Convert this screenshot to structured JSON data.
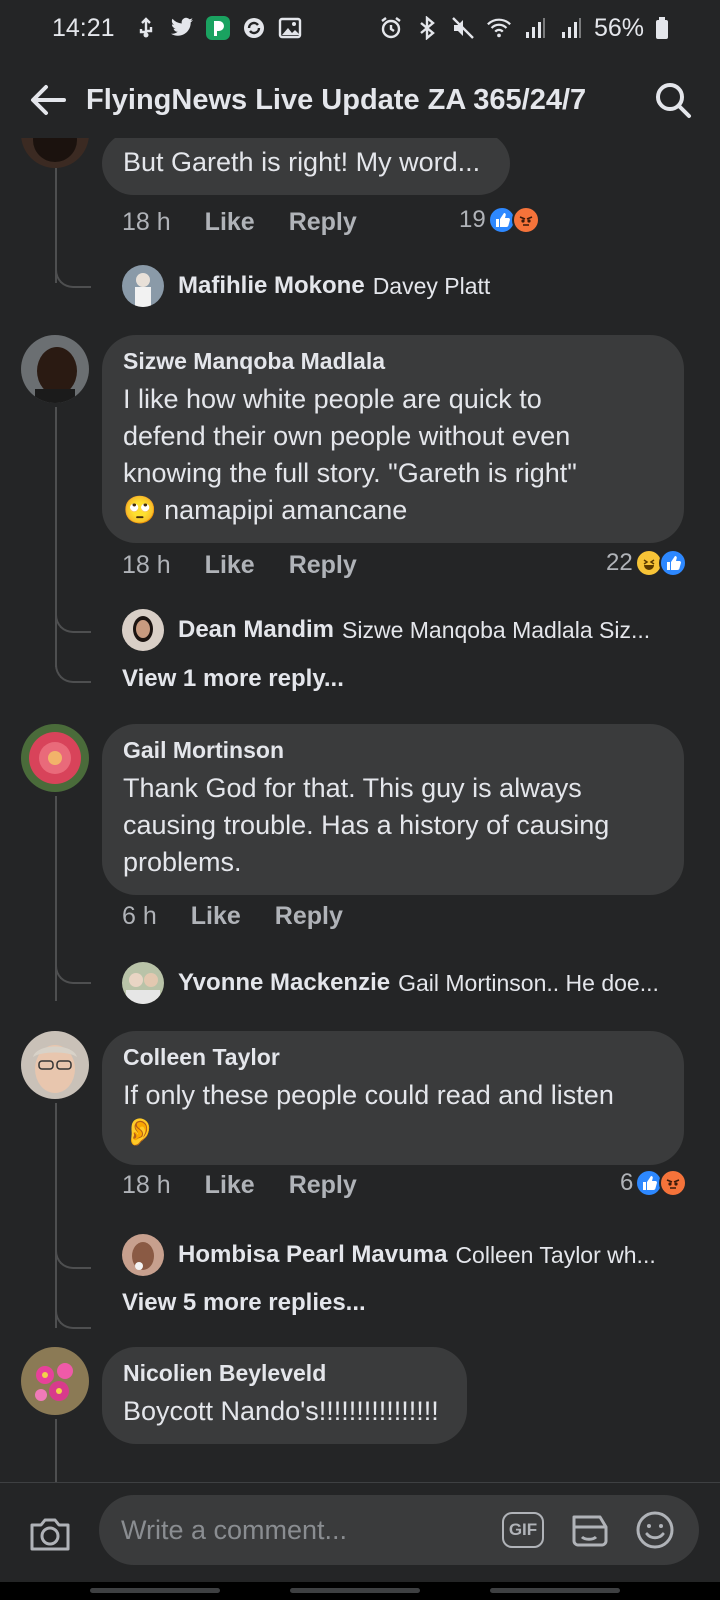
{
  "status_bar": {
    "time": "14:21",
    "battery": "56%",
    "left_icons": [
      "usb-icon",
      "twitter-icon",
      "p-app-icon",
      "sync-icon",
      "image-icon"
    ],
    "right_icons": [
      "alarm-icon",
      "bluetooth-icon",
      "mute-icon",
      "wifi-icon",
      "signal-icon",
      "signal-icon",
      "battery-icon"
    ]
  },
  "header": {
    "title": "FlyingNews Live Update ZA 365/24/7"
  },
  "comments": [
    {
      "name": "",
      "text": "But Gareth is right! My word...",
      "time": "18 h",
      "like_label": "Like",
      "reply_label": "Reply",
      "reaction_count": "19",
      "reactions": [
        "like",
        "angry"
      ],
      "reply_preview": {
        "name": "Mafihlie Mokone",
        "text": "Davey Platt"
      }
    },
    {
      "name": "Sizwe Manqoba Madlala",
      "text_lines": [
        "I like how white people are quick to",
        "defend their own people without even",
        "knowing the full story. \"Gareth is right\""
      ],
      "last_line_emoji": "🙄",
      "last_line_text": "namapipi amancane",
      "time": "18 h",
      "like_label": "Like",
      "reply_label": "Reply",
      "reaction_count": "22",
      "reactions": [
        "haha",
        "like"
      ],
      "reply_preview": {
        "name": "Dean Mandim",
        "text": "Sizwe Manqoba Madlala Siz..."
      },
      "more_replies": "View 1 more reply..."
    },
    {
      "name": "Gail Mortinson",
      "text_lines": [
        "Thank God for that. This guy is always",
        "causing trouble. Has a history of causing",
        "problems."
      ],
      "time": "6 h",
      "like_label": "Like",
      "reply_label": "Reply",
      "reply_preview": {
        "name": "Yvonne Mackenzie",
        "text": "Gail Mortinson.. He doe..."
      }
    },
    {
      "name": "Colleen Taylor",
      "text_lines": [
        "If only these people could read and listen"
      ],
      "emoji_line": "👂",
      "time": "18 h",
      "like_label": "Like",
      "reply_label": "Reply",
      "reaction_count": "6",
      "reactions": [
        "like",
        "angry"
      ],
      "reply_preview": {
        "name": "Hombisa Pearl Mavuma",
        "text": "Colleen Taylor wh..."
      },
      "more_replies": "View 5 more replies..."
    },
    {
      "name": "Nicolien Beyleveld",
      "text": "Boycott Nando's!!!!!!!!!!!!!!!!"
    }
  ],
  "composer": {
    "placeholder": "Write a comment...",
    "gif_label": "GIF"
  },
  "colors": {
    "background": "#242526",
    "bubble": "#3a3b3c",
    "like_blue": "#2d88ff",
    "angry_orange": "#f5733a",
    "haha_yellow": "#f7c437"
  }
}
